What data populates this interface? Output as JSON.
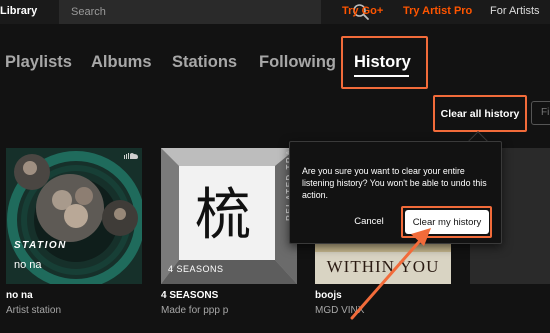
{
  "topbar": {
    "library_label": "Library",
    "search_placeholder": "Search",
    "links": [
      "Try Go+",
      "Try Artist Pro",
      "For Artists"
    ]
  },
  "tabs": [
    {
      "label": "Playlists",
      "active": false
    },
    {
      "label": "Albums",
      "active": false
    },
    {
      "label": "Stations",
      "active": false
    },
    {
      "label": "Following",
      "active": false
    },
    {
      "label": "History",
      "active": true
    }
  ],
  "actions": {
    "clear_all": "Clear all history",
    "filter_partial": "Fi"
  },
  "cards": [
    {
      "title": "no na",
      "subtitle": "Artist station",
      "overlay_type": "STATION",
      "overlay_name": "no na"
    },
    {
      "title": "4 SEASONS",
      "subtitle": "Made for ppp p",
      "overlay_name": "4 SEASONS",
      "side_label": "RELATED TRACKS",
      "glyph": "梳"
    },
    {
      "title": "boojs",
      "subtitle": "MGD VINX",
      "art_text": "WITHIN YOU"
    }
  ],
  "popover": {
    "message": "Are you sure you want to clear your entire listening history? You won't be able to undo this action.",
    "cancel_label": "Cancel",
    "confirm_label": "Clear my history"
  },
  "colors": {
    "accent": "#ff5500",
    "annotation": "#f26b3a",
    "background": "#121212"
  }
}
